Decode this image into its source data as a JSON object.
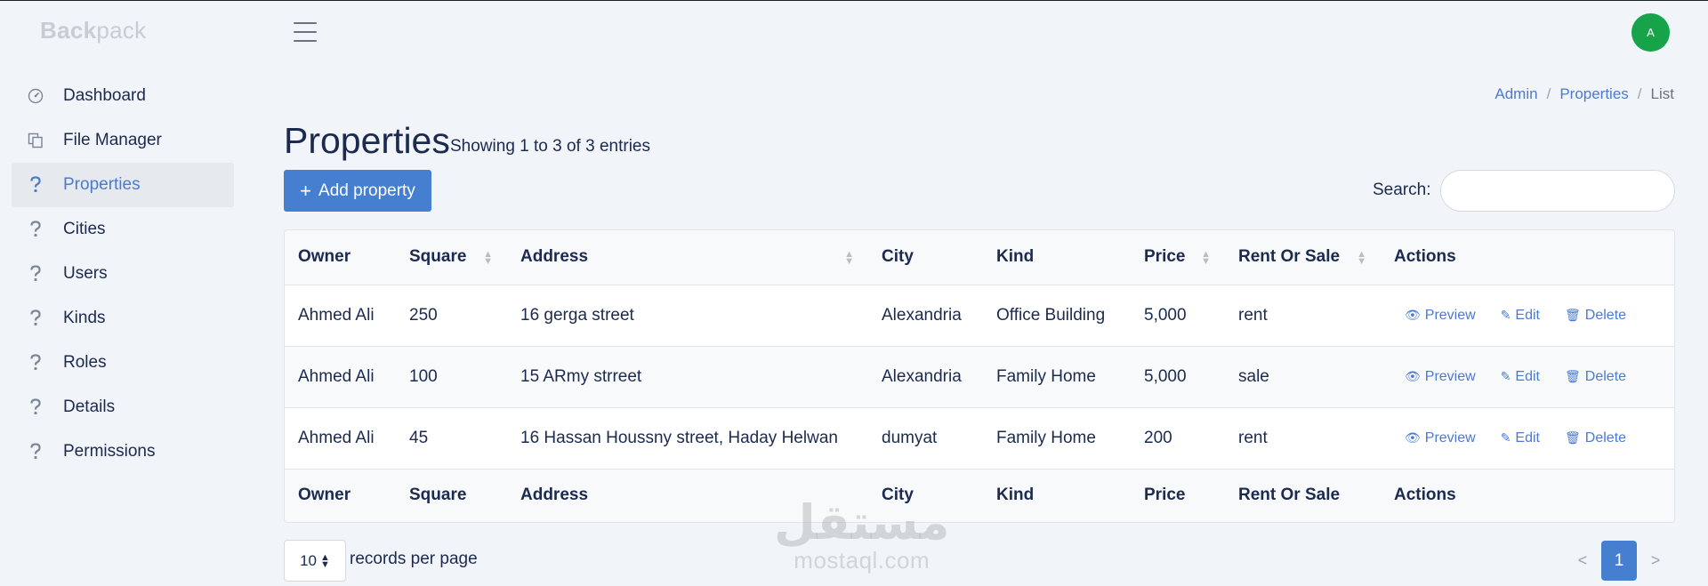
{
  "brand": {
    "bold": "Back",
    "light": "pack"
  },
  "avatar": {
    "initial": "A"
  },
  "sidebar": {
    "items": [
      {
        "label": "Dashboard",
        "icon": "dashboard-icon"
      },
      {
        "label": "File Manager",
        "icon": "files-icon"
      },
      {
        "label": "Properties",
        "icon": "question-icon",
        "active": true
      },
      {
        "label": "Cities",
        "icon": "question-icon"
      },
      {
        "label": "Users",
        "icon": "question-icon"
      },
      {
        "label": "Kinds",
        "icon": "question-icon"
      },
      {
        "label": "Roles",
        "icon": "question-icon"
      },
      {
        "label": "Details",
        "icon": "question-icon"
      },
      {
        "label": "Permissions",
        "icon": "question-icon"
      }
    ]
  },
  "breadcrumb": {
    "items": [
      "Admin",
      "Properties",
      "List"
    ],
    "separator": "/"
  },
  "page": {
    "title": "Properties",
    "subtitle": "Showing 1 to 3 of 3 entries",
    "add_button": "Add property",
    "search_label": "Search:",
    "search_value": ""
  },
  "table": {
    "columns": [
      "Owner",
      "Square",
      "Address",
      "City",
      "Kind",
      "Price",
      "Rent Or Sale",
      "Actions"
    ],
    "rows": [
      [
        "Ahmed Ali",
        "250",
        "16 gerga street",
        "Alexandria",
        "Office Building",
        "5,000",
        "rent"
      ],
      [
        "Ahmed Ali",
        "100",
        "15 ARmy strreet",
        "Alexandria",
        "Family Home",
        "5,000",
        "sale"
      ],
      [
        "Ahmed Ali",
        "45",
        "16 Hassan Houssny street, Haday Helwan",
        "dumyat",
        "Family Home",
        "200",
        "rent"
      ]
    ],
    "actions": {
      "preview": "Preview",
      "edit": "Edit",
      "delete": "Delete"
    }
  },
  "pagination": {
    "per_page": "10",
    "per_page_label": "records per page",
    "prev": "<",
    "current": "1",
    "next": ">"
  },
  "watermark": {
    "arabic": "مستقل",
    "latin": "mostaql.com"
  },
  "colors": {
    "primary": "#467fd0",
    "avatar": "#16a34a",
    "background": "#f1f4f8"
  }
}
